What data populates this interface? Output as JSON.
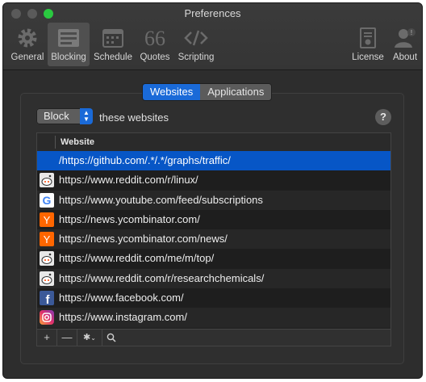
{
  "window": {
    "title": "Preferences"
  },
  "toolbar": [
    {
      "label": "General",
      "icon": "gear-icon"
    },
    {
      "label": "Blocking",
      "icon": "blocking-list-icon",
      "active": true
    },
    {
      "label": "Schedule",
      "icon": "calendar-icon"
    },
    {
      "label": "Quotes",
      "icon": "quote-icon"
    },
    {
      "label": "Scripting",
      "icon": "code-icon"
    },
    {
      "label": "License",
      "icon": "license-icon"
    },
    {
      "label": "About",
      "icon": "person-info-icon"
    }
  ],
  "segments": {
    "websites": "Websites",
    "applications": "Applications",
    "selected": "Websites"
  },
  "rule": {
    "mode": "Block",
    "suffix": "these websites",
    "help": "?"
  },
  "table": {
    "column": "Website",
    "rows": [
      {
        "url": "/https://github.com/.*/.*/graphs/traffic/",
        "icon": "none",
        "selected": true
      },
      {
        "url": "https://www.reddit.com/r/linux/",
        "icon": "reddit-icon"
      },
      {
        "url": "https://www.youtube.com/feed/subscriptions",
        "icon": "google-icon"
      },
      {
        "url": "https://news.ycombinator.com/",
        "icon": "ycombinator-icon"
      },
      {
        "url": "https://news.ycombinator.com/news/",
        "icon": "ycombinator-icon"
      },
      {
        "url": "https://www.reddit.com/me/m/top/",
        "icon": "reddit-icon"
      },
      {
        "url": "https://www.reddit.com/r/researchchemicals/",
        "icon": "reddit-icon"
      },
      {
        "url": "https://www.facebook.com/",
        "icon": "facebook-icon"
      },
      {
        "url": "https://www.instagram.com/",
        "icon": "instagram-icon"
      }
    ]
  },
  "colors": {
    "accent": "#1a6ad8",
    "selection": "#0756c6"
  }
}
